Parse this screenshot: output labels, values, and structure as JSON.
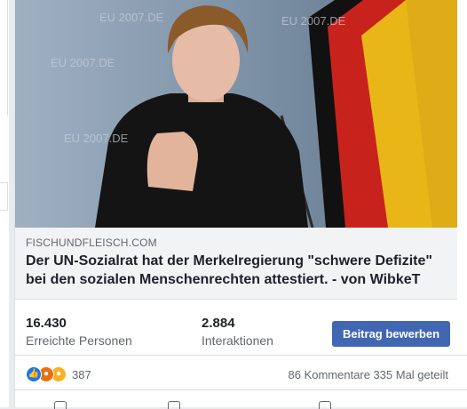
{
  "post": {
    "link": {
      "domain": "FISCHUNDFLEISCH.COM",
      "headline": "Der UN-Sozialrat hat der Merkelregierung \"schwere Defizite\" bei den sozialen Menschenrechten attestiert. - von WibkeT"
    },
    "insights": {
      "reach_value": "16.430",
      "reach_label": "Erreichte Personen",
      "engagement_value": "2.884",
      "engagement_label": "Interaktionen",
      "boost_label": "Beitrag bewerben"
    },
    "social": {
      "reaction_icons": [
        "like-icon",
        "angry-icon",
        "sad-icon"
      ],
      "reaction_count": "387",
      "comments": "86 Kommentare",
      "shares": "335 Mal geteilt"
    }
  },
  "colors": {
    "boost_button": "#4267b2",
    "flag_black": "#000000",
    "flag_red": "#dd0000",
    "flag_gold": "#ffce00"
  }
}
